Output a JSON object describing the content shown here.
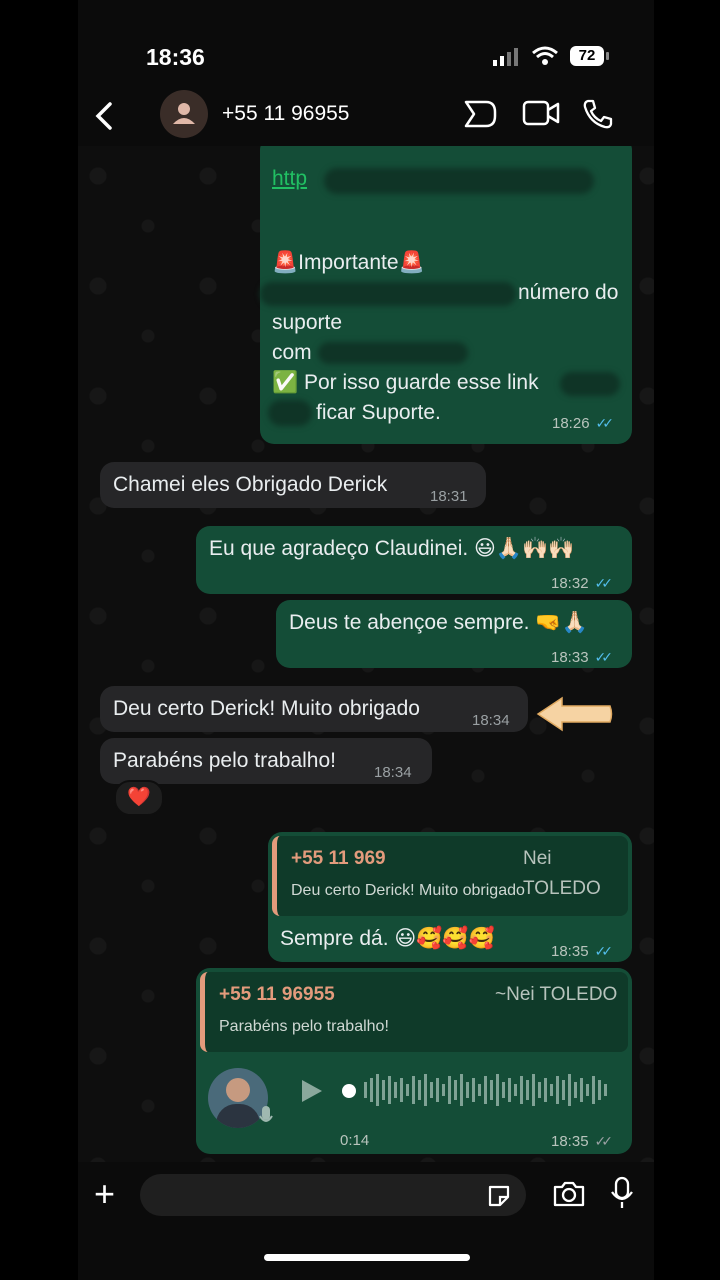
{
  "status": {
    "time": "18:36",
    "battery": "72"
  },
  "header": {
    "contact": "+55 11 96955"
  },
  "messages": {
    "m1": {
      "link": "http",
      "important": "🚨Importante🚨",
      "line2": "número do",
      "line3": "suporte",
      "line4": "com",
      "line5": "✅ Por isso guarde esse link",
      "line6": "ficar Suporte.",
      "time": "18:26"
    },
    "m2": {
      "text": "Chamei eles Obrigado Derick",
      "time": "18:31"
    },
    "m3": {
      "text": "Eu que agradeço Claudinei. 😃🙏🏻🙌🏻🙌🏻",
      "time": "18:32"
    },
    "m4": {
      "text": "Deus te abençoe sempre. 🤜🙏🏻",
      "time": "18:33"
    },
    "m5": {
      "text": "Deu certo Derick! Muito obrigado",
      "time": "18:34"
    },
    "m6": {
      "text": "Parabéns pelo trabalho!",
      "time": "18:34",
      "reaction": "❤️"
    },
    "m7": {
      "quote_number": "+55 11 969",
      "quote_name": "Nei TOLEDO",
      "quote_text": "Deu certo Derick! Muito obrigado",
      "text": "Sempre dá. 😃🥰🥰🥰",
      "time": "18:35"
    },
    "m8": {
      "quote_number": "+55 11 96955",
      "quote_name": "~Nei TOLEDO",
      "quote_text": "Parabéns pelo trabalho!",
      "duration": "0:14",
      "time": "18:35"
    }
  },
  "colors": {
    "outgoing": "#144d37",
    "incoming": "#262628",
    "quote_accent": "#e39b7c",
    "ticks_read": "#53bdeb"
  },
  "icons": [
    "back-icon",
    "contact-avatar-icon",
    "sticker-icon",
    "video-call-icon",
    "phone-icon",
    "play-icon",
    "mic-icon",
    "camera-icon",
    "plus-icon"
  ]
}
